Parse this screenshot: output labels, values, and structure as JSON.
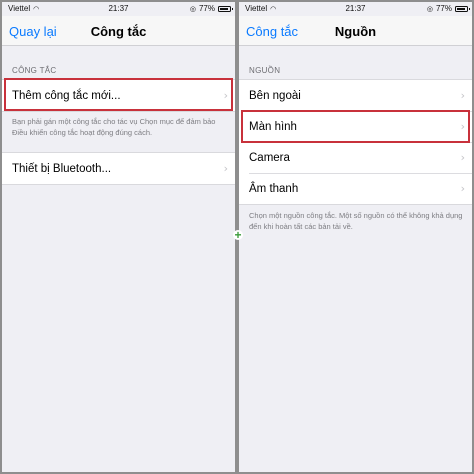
{
  "left": {
    "status": {
      "carrier": "Viettel",
      "time": "21:37",
      "battery": "77%",
      "battery_level": 0.77
    },
    "nav": {
      "back": "Quay lại",
      "title": "Công tắc"
    },
    "section_header": "CÔNG TẮC",
    "items": [
      {
        "label": "Thêm công tắc mới..."
      }
    ],
    "note": "Bạn phải gán một công tắc cho tác vụ Chọn mục để đảm bảo Điều khiển công tắc hoạt động đúng cách.",
    "items2": [
      {
        "label": "Thiết bị Bluetooth..."
      }
    ]
  },
  "right": {
    "status": {
      "carrier": "Viettel",
      "time": "21:37",
      "battery": "77%",
      "battery_level": 0.77
    },
    "nav": {
      "back": "Công tắc",
      "title": "Nguồn"
    },
    "section_header": "NGUỒN",
    "items": [
      {
        "label": "Bên ngoài"
      },
      {
        "label": "Màn hình"
      },
      {
        "label": "Camera"
      },
      {
        "label": "Âm thanh"
      }
    ],
    "note": "Chọn một nguồn công tắc. Một số nguồn có thể không khả dụng đến khi hoàn tất các bản tải về."
  },
  "icons": {
    "chevron": "›",
    "wifi": "wifi-icon",
    "lock": "rotation-lock-icon"
  },
  "colors": {
    "accent": "#0a7aff",
    "highlight": "#c8313b",
    "background": "#efeff4"
  }
}
